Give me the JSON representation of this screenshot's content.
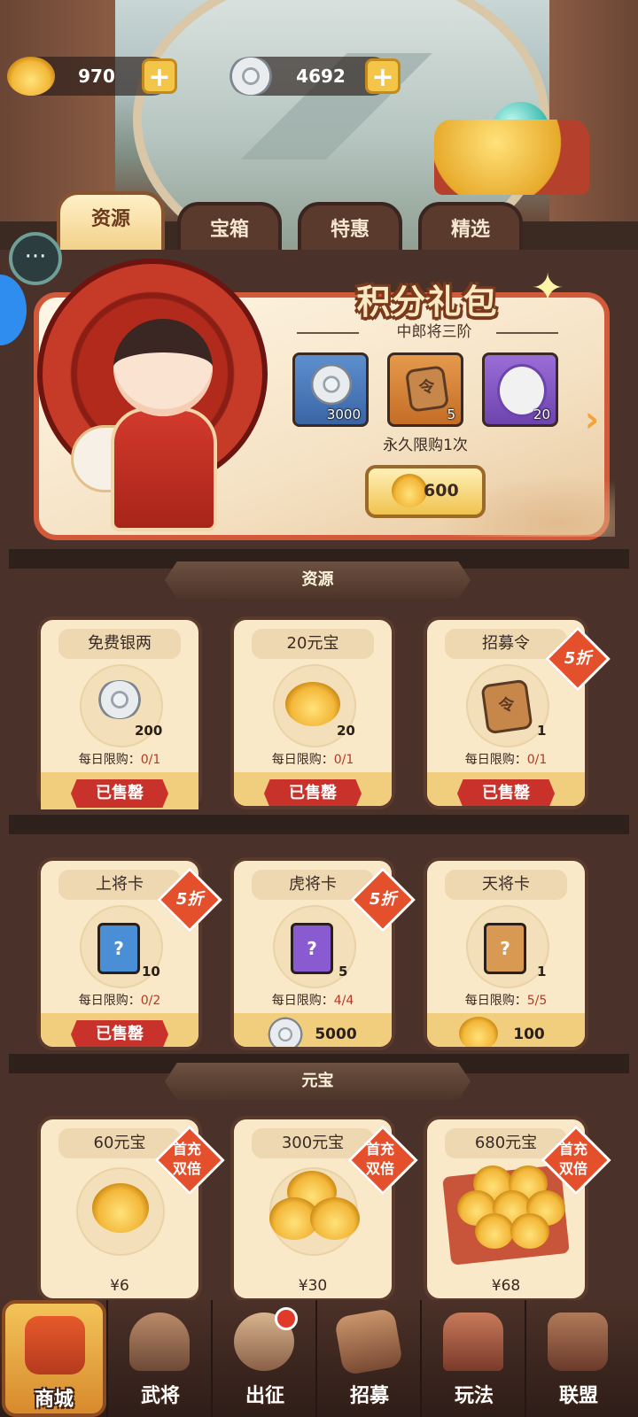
{
  "currency": {
    "gold_ingot": {
      "icon": "gold-ingot-icon",
      "value": "970"
    },
    "silver_coin": {
      "icon": "silver-coin-icon",
      "value": "4692"
    },
    "plus_symbol": "+"
  },
  "tabs": [
    {
      "label": "资源",
      "active": true
    },
    {
      "label": "宝箱",
      "active": false
    },
    {
      "label": "特惠",
      "active": false
    },
    {
      "label": "精选",
      "active": false
    }
  ],
  "featured": {
    "title": "积分礼包",
    "subtitle": "中郎将三阶",
    "rewards": [
      {
        "icon": "silver-coin-icon",
        "qty": "3000"
      },
      {
        "icon": "recruit-token-icon",
        "qty": "5",
        "glyph": "令"
      },
      {
        "icon": "hero-portrait-icon",
        "qty": "20"
      }
    ],
    "limit": "永久限购1次",
    "price": "600",
    "next_arrow": "›"
  },
  "sections": {
    "resources_title": "资源",
    "ingot_title": "元宝"
  },
  "resource_cards": [
    {
      "title": "免费银两",
      "icon": "silver-coin-icon",
      "qty": "200",
      "limit_label": "每日限购：",
      "limit_count": "0/1",
      "action": "已售罄"
    },
    {
      "title": "20元宝",
      "icon": "gold-ingot-icon",
      "qty": "20",
      "limit_label": "每日限购：",
      "limit_count": "0/1",
      "action": "已售罄"
    },
    {
      "title": "招募令",
      "icon": "recruit-token-icon",
      "qty": "1",
      "limit_label": "每日限购：",
      "limit_count": "0/1",
      "action": "已售罄",
      "badge": "5折"
    },
    {
      "title": "上将卡",
      "icon": "blue-card-icon",
      "qty": "10",
      "limit_label": "每日限购：",
      "limit_count": "0/2",
      "action": "已售罄",
      "badge": "5折"
    },
    {
      "title": "虎将卡",
      "icon": "purple-card-icon",
      "qty": "5",
      "limit_label": "每日限购：",
      "limit_count": "4/4",
      "price": "5000",
      "price_icon": "silver-coin-icon",
      "badge": "5折"
    },
    {
      "title": "天将卡",
      "icon": "orange-card-icon",
      "qty": "1",
      "limit_label": "每日限购：",
      "limit_count": "5/5",
      "price": "100",
      "price_icon": "gold-ingot-icon"
    }
  ],
  "ingot_cards": [
    {
      "title": "60元宝",
      "badge_line1": "首充",
      "badge_line2": "双倍",
      "price": "¥6"
    },
    {
      "title": "300元宝",
      "badge_line1": "首充",
      "badge_line2": "双倍",
      "price": "¥30"
    },
    {
      "title": "680元宝",
      "badge_line1": "首充",
      "badge_line2": "双倍",
      "price": "¥68"
    }
  ],
  "card_glyph": "?",
  "nav": [
    {
      "label": "商城",
      "active": true
    },
    {
      "label": "武将",
      "active": false
    },
    {
      "label": "出征",
      "active": false,
      "notification": true
    },
    {
      "label": "招募",
      "active": false
    },
    {
      "label": "玩法",
      "active": false
    },
    {
      "label": "联盟",
      "active": false
    }
  ],
  "colors": {
    "accent_gold": "#f3c649",
    "sold_out_red": "#c8322a",
    "discount_badge": "#e5502c",
    "panel_bg": "#4a322a"
  }
}
